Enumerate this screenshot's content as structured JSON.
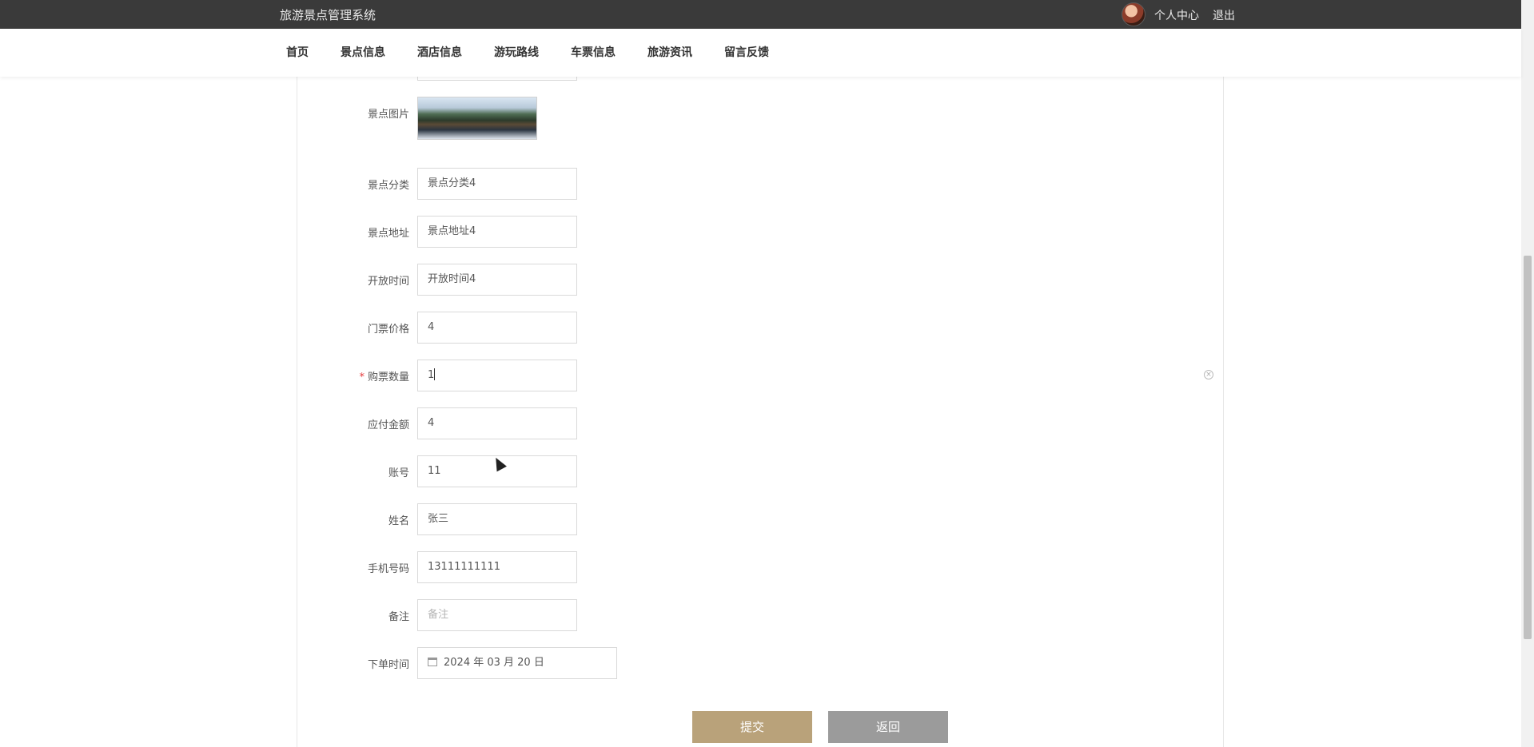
{
  "header": {
    "system_title": "旅游景点管理系统",
    "personal_center": "个人中心",
    "logout": "退出"
  },
  "nav": {
    "items": [
      "首页",
      "景点信息",
      "酒店信息",
      "游玩路线",
      "车票信息",
      "旅游资讯",
      "留言反馈"
    ]
  },
  "form": {
    "image_label": "景点图片",
    "category": {
      "label": "景点分类",
      "value": "景点分类4"
    },
    "address": {
      "label": "景点地址",
      "value": "景点地址4"
    },
    "open_time": {
      "label": "开放时间",
      "value": "开放时间4"
    },
    "ticket_price": {
      "label": "门票价格",
      "value": "4"
    },
    "quantity": {
      "label": "购票数量",
      "value": "1",
      "required_mark": "*"
    },
    "amount_due": {
      "label": "应付金额",
      "value": "4"
    },
    "account": {
      "label": "账号",
      "value": "11"
    },
    "name": {
      "label": "姓名",
      "value": "张三"
    },
    "phone": {
      "label": "手机号码",
      "value": "13111111111"
    },
    "remark": {
      "label": "备注",
      "placeholder": "备注"
    },
    "order_time": {
      "label": "下单时间",
      "value": "2024 年 03 月 20 日"
    }
  },
  "buttons": {
    "submit": "提交",
    "back": "返回"
  },
  "icons": {
    "calendar": "calendar-icon",
    "clear": "clear-icon"
  }
}
